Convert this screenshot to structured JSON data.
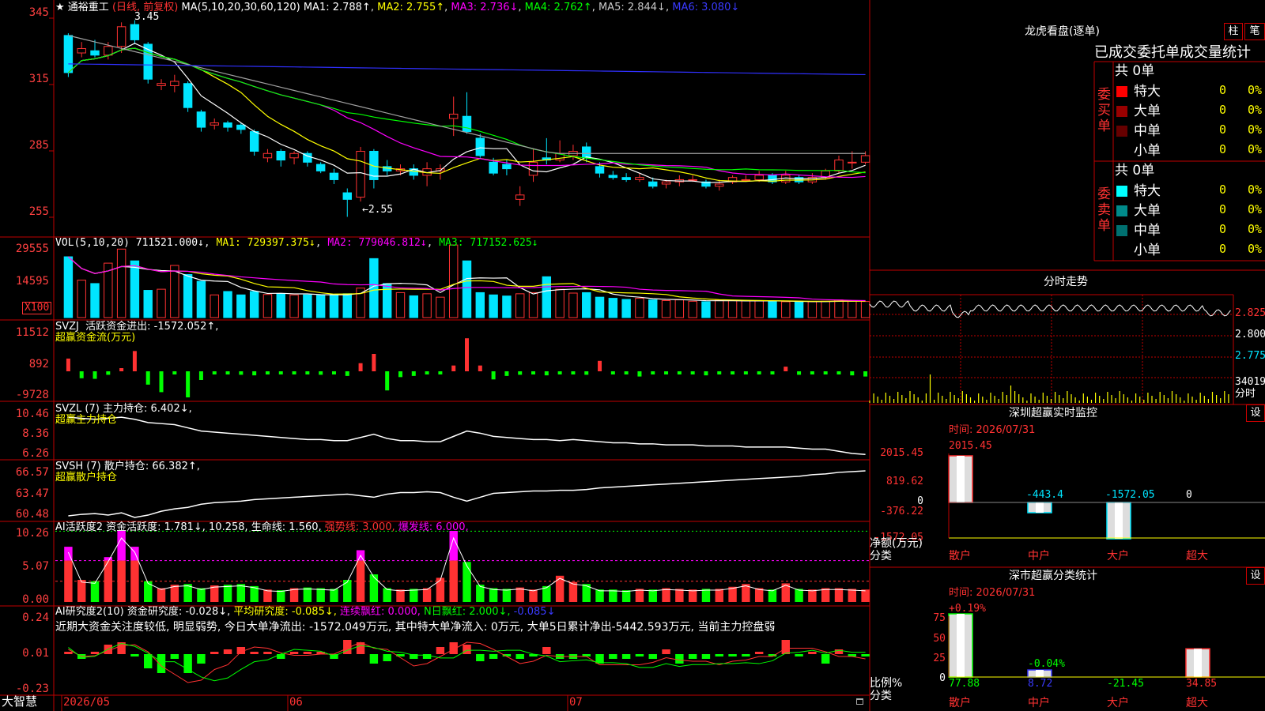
{
  "colors": {
    "up": "#ff3232",
    "down": "#00e5ff",
    "grid": "#c00000",
    "white": "#ffffff",
    "yellow": "#ffff00",
    "magenta": "#ff00ff",
    "green": "#00ff00",
    "blue": "#3030ff",
    "gray": "#a0a0a0"
  },
  "header": {
    "star": "★",
    "stock_name": "通裕重工",
    "period": "(日线, 前复权)",
    "ma_label": "MA(5,10,20,30,60,120)",
    "ma1": "MA1: 2.788↑",
    "ma2": "MA2: 2.755↑",
    "ma3": "MA3: 2.736↓",
    "ma4": "MA4: 2.762↑",
    "ma5": "MA5: 2.844↓",
    "ma6": "MA6: 3.080↓"
  },
  "price_panel": {
    "axis": [
      "345",
      "315",
      "285",
      "255"
    ],
    "high_mark": "3.45",
    "low_mark": "←2.55",
    "candles": [
      [
        3.38,
        3.21,
        3.39,
        3.19
      ],
      [
        3.3,
        3.32,
        3.35,
        3.28
      ],
      [
        3.31,
        3.29,
        3.36,
        3.28
      ],
      [
        3.29,
        3.33,
        3.35,
        3.27
      ],
      [
        3.33,
        3.42,
        3.44,
        3.3
      ],
      [
        3.43,
        3.36,
        3.45,
        3.34
      ],
      [
        3.34,
        3.18,
        3.35,
        3.16
      ],
      [
        3.15,
        3.16,
        3.18,
        3.13
      ],
      [
        3.15,
        3.17,
        3.2,
        3.12
      ],
      [
        3.16,
        3.05,
        3.17,
        3.03
      ],
      [
        3.03,
        2.96,
        3.04,
        2.94
      ],
      [
        2.97,
        2.98,
        3.0,
        2.95
      ],
      [
        2.98,
        2.96,
        2.99,
        2.94
      ],
      [
        2.97,
        2.95,
        2.98,
        2.93
      ],
      [
        2.94,
        2.85,
        2.95,
        2.83
      ],
      [
        2.82,
        2.84,
        2.86,
        2.8
      ],
      [
        2.85,
        2.81,
        2.86,
        2.78
      ],
      [
        2.82,
        2.84,
        2.85,
        2.79
      ],
      [
        2.84,
        2.8,
        2.85,
        2.78
      ],
      [
        2.79,
        2.76,
        2.8,
        2.75
      ],
      [
        2.75,
        2.72,
        2.77,
        2.7
      ],
      [
        2.66,
        2.63,
        2.68,
        2.55
      ],
      [
        2.64,
        2.85,
        2.87,
        2.62
      ],
      [
        2.85,
        2.72,
        2.86,
        2.68
      ],
      [
        2.78,
        2.76,
        2.81,
        2.74
      ],
      [
        2.76,
        2.77,
        2.79,
        2.74
      ],
      [
        2.77,
        2.74,
        2.79,
        2.72
      ],
      [
        2.74,
        2.77,
        2.8,
        2.69
      ],
      [
        2.76,
        2.77,
        2.79,
        2.72
      ],
      [
        3.0,
        3.02,
        3.1,
        2.92
      ],
      [
        3.01,
        2.94,
        3.12,
        2.93
      ],
      [
        2.91,
        2.83,
        2.93,
        2.82
      ],
      [
        2.8,
        2.75,
        2.82,
        2.74
      ],
      [
        2.79,
        2.77,
        2.81,
        2.74
      ],
      [
        2.63,
        2.65,
        2.69,
        2.6
      ],
      [
        2.74,
        2.8,
        2.86,
        2.71
      ],
      [
        2.82,
        2.81,
        2.91,
        2.79
      ],
      [
        2.81,
        2.84,
        2.9,
        2.8
      ],
      [
        2.83,
        2.85,
        2.88,
        2.81
      ],
      [
        2.87,
        2.82,
        2.89,
        2.8
      ],
      [
        2.78,
        2.75,
        2.8,
        2.73
      ],
      [
        2.74,
        2.73,
        2.76,
        2.72
      ],
      [
        2.73,
        2.72,
        2.75,
        2.71
      ],
      [
        2.72,
        2.73,
        2.75,
        2.71
      ],
      [
        2.71,
        2.69,
        2.73,
        2.68
      ],
      [
        2.7,
        2.71,
        2.72,
        2.68
      ],
      [
        2.71,
        2.72,
        2.74,
        2.69
      ],
      [
        2.72,
        2.72,
        2.74,
        2.71
      ],
      [
        2.71,
        2.69,
        2.72,
        2.68
      ],
      [
        2.69,
        2.7,
        2.72,
        2.67
      ],
      [
        2.71,
        2.73,
        2.74,
        2.7
      ],
      [
        2.72,
        2.72,
        2.74,
        2.71
      ],
      [
        2.72,
        2.74,
        2.76,
        2.71
      ],
      [
        2.74,
        2.71,
        2.75,
        2.7
      ],
      [
        2.71,
        2.74,
        2.76,
        2.7
      ],
      [
        2.73,
        2.71,
        2.74,
        2.7
      ],
      [
        2.71,
        2.73,
        2.75,
        2.7
      ],
      [
        2.73,
        2.76,
        2.77,
        2.72
      ],
      [
        2.76,
        2.81,
        2.83,
        2.75
      ],
      [
        2.8,
        2.8,
        2.85,
        2.77
      ],
      [
        2.8,
        2.83,
        2.85,
        2.79
      ]
    ]
  },
  "vol_panel": {
    "title": "VOL(5,10,20)",
    "v": "711521.000↓",
    "ma1": "MA1: 729397.375↓",
    "ma2": "MA2: 779046.812↓",
    "ma3": "MA3: 717152.625↓",
    "axis": [
      "29555",
      "14595"
    ],
    "unit": "X100",
    "values": [
      26800,
      16500,
      15000,
      24000,
      30200,
      25000,
      12000,
      12500,
      23000,
      19000,
      16000,
      10000,
      11500,
      10000,
      11500,
      10200,
      10500,
      10000,
      10000,
      9800,
      10000,
      10500,
      13000,
      26000,
      15000,
      11000,
      9600,
      10500,
      9000,
      32000,
      25000,
      11000,
      10000,
      9500,
      10500,
      11000,
      18000,
      12500,
      10800,
      11000,
      9000,
      8500,
      8000,
      8500,
      7800,
      7500,
      7800,
      7200,
      7000,
      7600,
      7500,
      7400,
      7300,
      7200,
      7000,
      6800,
      7000,
      7200,
      7800,
      7400,
      7100
    ]
  },
  "svzj_panel": {
    "title": "SVZJ",
    "label": "活跃资金进出: -1572.052↑,",
    "sub": "超赢资金流(万元)",
    "axis": [
      "11512",
      "892",
      "-9728"
    ],
    "values": [
      2200,
      -1200,
      -1300,
      -600,
      300,
      3500,
      -2300,
      -3600,
      -200,
      -4500,
      -1500,
      -400,
      -200,
      -600,
      -700,
      -400,
      -400,
      -500,
      -500,
      -600,
      -400,
      -800,
      1400,
      3000,
      -3300,
      -1000,
      -800,
      -200,
      -500,
      1000,
      5700,
      1000,
      -1400,
      -800,
      -600,
      -500,
      -700,
      -300,
      -400,
      -600,
      1800,
      -400,
      -300,
      -900,
      -400,
      -500,
      -300,
      -400,
      -700,
      -300,
      -500,
      -400,
      -300,
      -400,
      800,
      -600,
      -500,
      -500,
      -500,
      -700,
      -900
    ]
  },
  "svzl_panel": {
    "title": "SVZL (7)",
    "label": "主力持仓: 6.402↓,",
    "sub": "超赢主力持仓",
    "axis": [
      "10.46",
      "8.36",
      "6.26"
    ],
    "values": [
      9.9,
      9.8,
      9.7,
      9.8,
      9.9,
      9.7,
      9.4,
      9.3,
      9.2,
      8.9,
      8.6,
      8.5,
      8.4,
      8.3,
      8.2,
      8.1,
      8.0,
      7.9,
      7.8,
      7.8,
      7.7,
      7.7,
      8.0,
      8.3,
      7.9,
      7.7,
      7.7,
      7.6,
      7.6,
      8.1,
      8.6,
      8.4,
      8.1,
      8.0,
      7.9,
      7.8,
      7.8,
      7.7,
      7.8,
      7.7,
      7.6,
      7.5,
      7.5,
      7.4,
      7.4,
      7.3,
      7.3,
      7.3,
      7.2,
      7.2,
      7.2,
      7.1,
      7.1,
      7.1,
      7.1,
      7.0,
      6.9,
      6.9,
      6.7,
      6.5,
      6.4
    ]
  },
  "svsh_panel": {
    "title": "SVSH (7)",
    "label": "散户持仓: 66.382↑,",
    "sub": "超赢散户持仓",
    "axis": [
      "66.57",
      "63.47",
      "60.48"
    ],
    "values": [
      60.6,
      60.8,
      60.9,
      60.7,
      61.0,
      60.4,
      60.7,
      61.2,
      61.5,
      61.7,
      62.1,
      62.3,
      62.4,
      62.5,
      62.7,
      62.8,
      62.9,
      63.0,
      63.1,
      63.2,
      63.3,
      63.4,
      63.2,
      63.0,
      63.4,
      63.6,
      63.6,
      63.7,
      63.6,
      63.0,
      62.5,
      63.0,
      63.5,
      63.6,
      63.7,
      63.8,
      63.8,
      63.9,
      63.9,
      64.0,
      64.2,
      64.3,
      64.4,
      64.5,
      64.6,
      64.7,
      64.8,
      64.9,
      65.0,
      65.1,
      65.2,
      65.3,
      65.4,
      65.5,
      65.6,
      65.7,
      65.9,
      66.0,
      66.2,
      66.3,
      66.4
    ]
  },
  "ai_panel": {
    "title": "AI活跃度2",
    "label": "资金活跃度: 1.781↓, 10.258, 生命线: 1.560,",
    "l1": "强势线: 3.000,",
    "l2": "爆发线: 6.000,",
    "axis": [
      "10.26",
      "5.07",
      "0.00"
    ],
    "values": [
      8.0,
      3.2,
      3.0,
      6.5,
      10.3,
      8.0,
      3.0,
      2.0,
      2.5,
      2.6,
      2.0,
      2.4,
      2.5,
      2.6,
      2.3,
      1.8,
      1.7,
      2.0,
      2.1,
      2.0,
      1.9,
      3.2,
      7.5,
      4.0,
      2.0,
      1.8,
      1.9,
      2.0,
      3.5,
      10.3,
      5.8,
      2.5,
      2.0,
      1.9,
      2.1,
      1.8,
      2.3,
      3.8,
      2.9,
      2.6,
      1.8,
      1.8,
      1.7,
      1.9,
      1.8,
      2.0,
      1.9,
      1.8,
      1.9,
      1.9,
      2.2,
      2.6,
      2.0,
      1.8,
      2.7,
      1.9,
      1.8,
      2.0,
      2.0,
      1.9,
      1.8
    ]
  },
  "ai_research": {
    "title": "AI研究度2(10)",
    "l1": "资金研究度: -0.028↓,",
    "l2": "平均研究度: -0.085↓,",
    "l3": "连续飘红: 0.000,",
    "l4": "N日飘红: 2.000↓,",
    "l5": "-0.085↓",
    "comment": "近期大资金关注度较低, 明显弱势, 今日大单净流出: -1572.049万元, 其中特大单净流入: 0万元, 大单5日累计净出-5442.593万元, 当前主力控盘弱",
    "axis": [
      "0.24",
      "0.01",
      "-0.23"
    ],
    "values": [
      0.01,
      -0.02,
      0.0,
      0.04,
      0.05,
      -0.01,
      -0.06,
      -0.08,
      -0.02,
      -0.08,
      -0.04,
      0.01,
      0.02,
      0.03,
      0.0,
      0.0,
      -0.02,
      0.01,
      0.0,
      0.01,
      -0.02,
      0.06,
      0.05,
      -0.04,
      -0.03,
      -0.01,
      -0.02,
      -0.02,
      0.03,
      0.05,
      0.04,
      -0.03,
      -0.02,
      -0.01,
      -0.02,
      -0.01,
      0.03,
      -0.02,
      -0.02,
      -0.01,
      -0.04,
      -0.02,
      -0.02,
      -0.01,
      -0.02,
      0.02,
      -0.04,
      -0.02,
      -0.02,
      -0.01,
      -0.01,
      -0.01,
      0.01,
      -0.01,
      0.06,
      -0.01,
      0.01,
      -0.04,
      0.02,
      -0.01,
      -0.01
    ]
  },
  "date_axis": {
    "brand": "大智慧",
    "d1": "2026/05",
    "d2": "06",
    "d3": "07"
  },
  "right": {
    "lhkp_title": "龙虎看盘(逐单)",
    "tab1": "柱",
    "tab2": "笔",
    "stats_title": "已成交委托单成交量统计",
    "buy_side": "委买单",
    "sell_side": "委卖单",
    "buy_total": "共 0单",
    "sell_total": "共 0单",
    "rows": [
      {
        "name": "特大",
        "n": "0",
        "p": "0%"
      },
      {
        "name": "大单",
        "n": "0",
        "p": "0%"
      },
      {
        "name": "中单",
        "n": "0",
        "p": "0%"
      },
      {
        "name": "小单",
        "n": "0",
        "p": "0%"
      }
    ],
    "fs_title": "分时走势",
    "fs_axis": [
      "2.825",
      "2.800",
      "2.775"
    ],
    "fs_vol_label": "34019",
    "fs_time_label": "分时",
    "sz_title": "深圳超赢实时监控",
    "sz_settings": "设",
    "sz_time": "时间: 2026/07/31",
    "sz_axis": [
      "2015.45",
      "819.62",
      "0",
      "-376.22",
      "-1572.05"
    ],
    "sz_vals": [
      "2015.45",
      "-443.4",
      "-1572.05",
      "0"
    ],
    "sz_values_num": [
      2015.45,
      -443.4,
      -1572.05,
      0
    ],
    "sz_unit": "净额(万元)",
    "sz_cat": "分类",
    "cats": [
      "散户",
      "中户",
      "大户",
      "超大"
    ],
    "fl_title": "深市超赢分类统计",
    "fl_settings": "设",
    "fl_time": "时间: 2026/07/31",
    "fl_top": "+0.19%",
    "fl_mid": "-0.04%",
    "fl_axis": [
      "75",
      "50",
      "25",
      "0"
    ],
    "fl_vals": [
      "77.88",
      "8.72",
      "-21.45",
      "34.85"
    ],
    "fl_values_num": [
      77.88,
      8.72,
      -21.45,
      34.85
    ],
    "fl_unit": "比例%",
    "fl_cat": "分类"
  }
}
